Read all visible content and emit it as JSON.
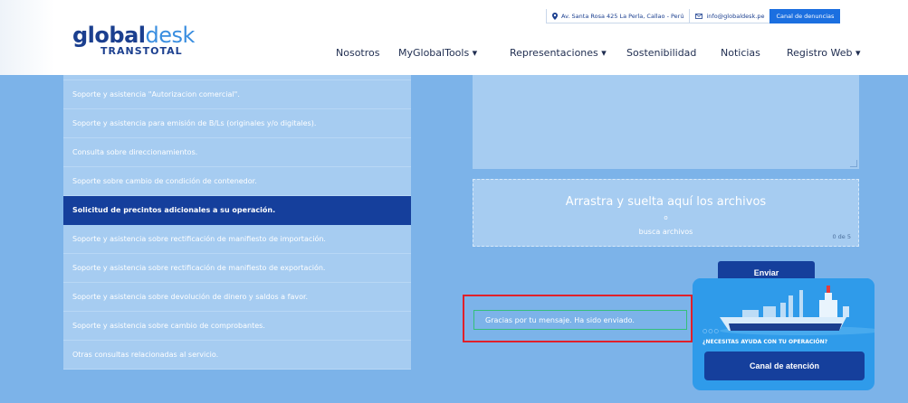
{
  "logo": {
    "part1": "glo",
    "part2": "bal",
    "part3": "desk",
    "subtitle": "TRANSTOTAL"
  },
  "topbar": {
    "address": "Av. Santa Rosa 425 La Perla, Callao - Perú",
    "email": "info@globaldesk.pe",
    "canal_denuncias": "Canal de denuncias",
    "address_icon": "map-pin-icon",
    "email_icon": "envelope-icon"
  },
  "nav": {
    "items": [
      {
        "label": "Nosotros"
      },
      {
        "label": "MyGlobalTools ▾"
      },
      {
        "label": "Representaciones ▾"
      },
      {
        "label": "Sostenibilidad"
      },
      {
        "label": "Noticias"
      },
      {
        "label": "Registro Web ▾"
      }
    ]
  },
  "services": {
    "active_index": 5,
    "items": [
      {
        "label": ""
      },
      {
        "label": "Soporte y asistencia \"Autorizacion comercial\"."
      },
      {
        "label": "Soporte y asistencia para emisión de B/Ls (originales y/o digitales)."
      },
      {
        "label": "Consulta sobre direccionamientos."
      },
      {
        "label": "Soporte sobre cambio de condición de contenedor."
      },
      {
        "label": "Solicitud de precintos adicionales a su operación."
      },
      {
        "label": "Soporte y asistencia sobre rectificación de manifiesto de importación."
      },
      {
        "label": "Soporte y asistencia sobre rectificación de manifiesto de exportación."
      },
      {
        "label": "Soporte y asistencia sobre devolución de dinero y saldos a favor."
      },
      {
        "label": "Soporte y asistencia sobre cambio de comprobantes."
      },
      {
        "label": "Otras consultas relacionadas al servicio."
      }
    ]
  },
  "upload": {
    "title": "Arrastra y suelta aquí los archivos",
    "or": "o",
    "browse": "busca archivos",
    "count": "0 de 5"
  },
  "form": {
    "send_label": "Enviar"
  },
  "alert": {
    "message": "Gracias por tu mensaje. Ha sido enviado."
  },
  "help": {
    "dots": "○○○",
    "question": "¿NECESITAS AYUDA CON TU OPERACIÓN?",
    "button": "Canal de atención"
  },
  "colors": {
    "brand_dark": "#153f9c",
    "brand_light": "#3a8ee0",
    "page_bg": "#7cb3e9",
    "alert_border": "#e0202a"
  }
}
